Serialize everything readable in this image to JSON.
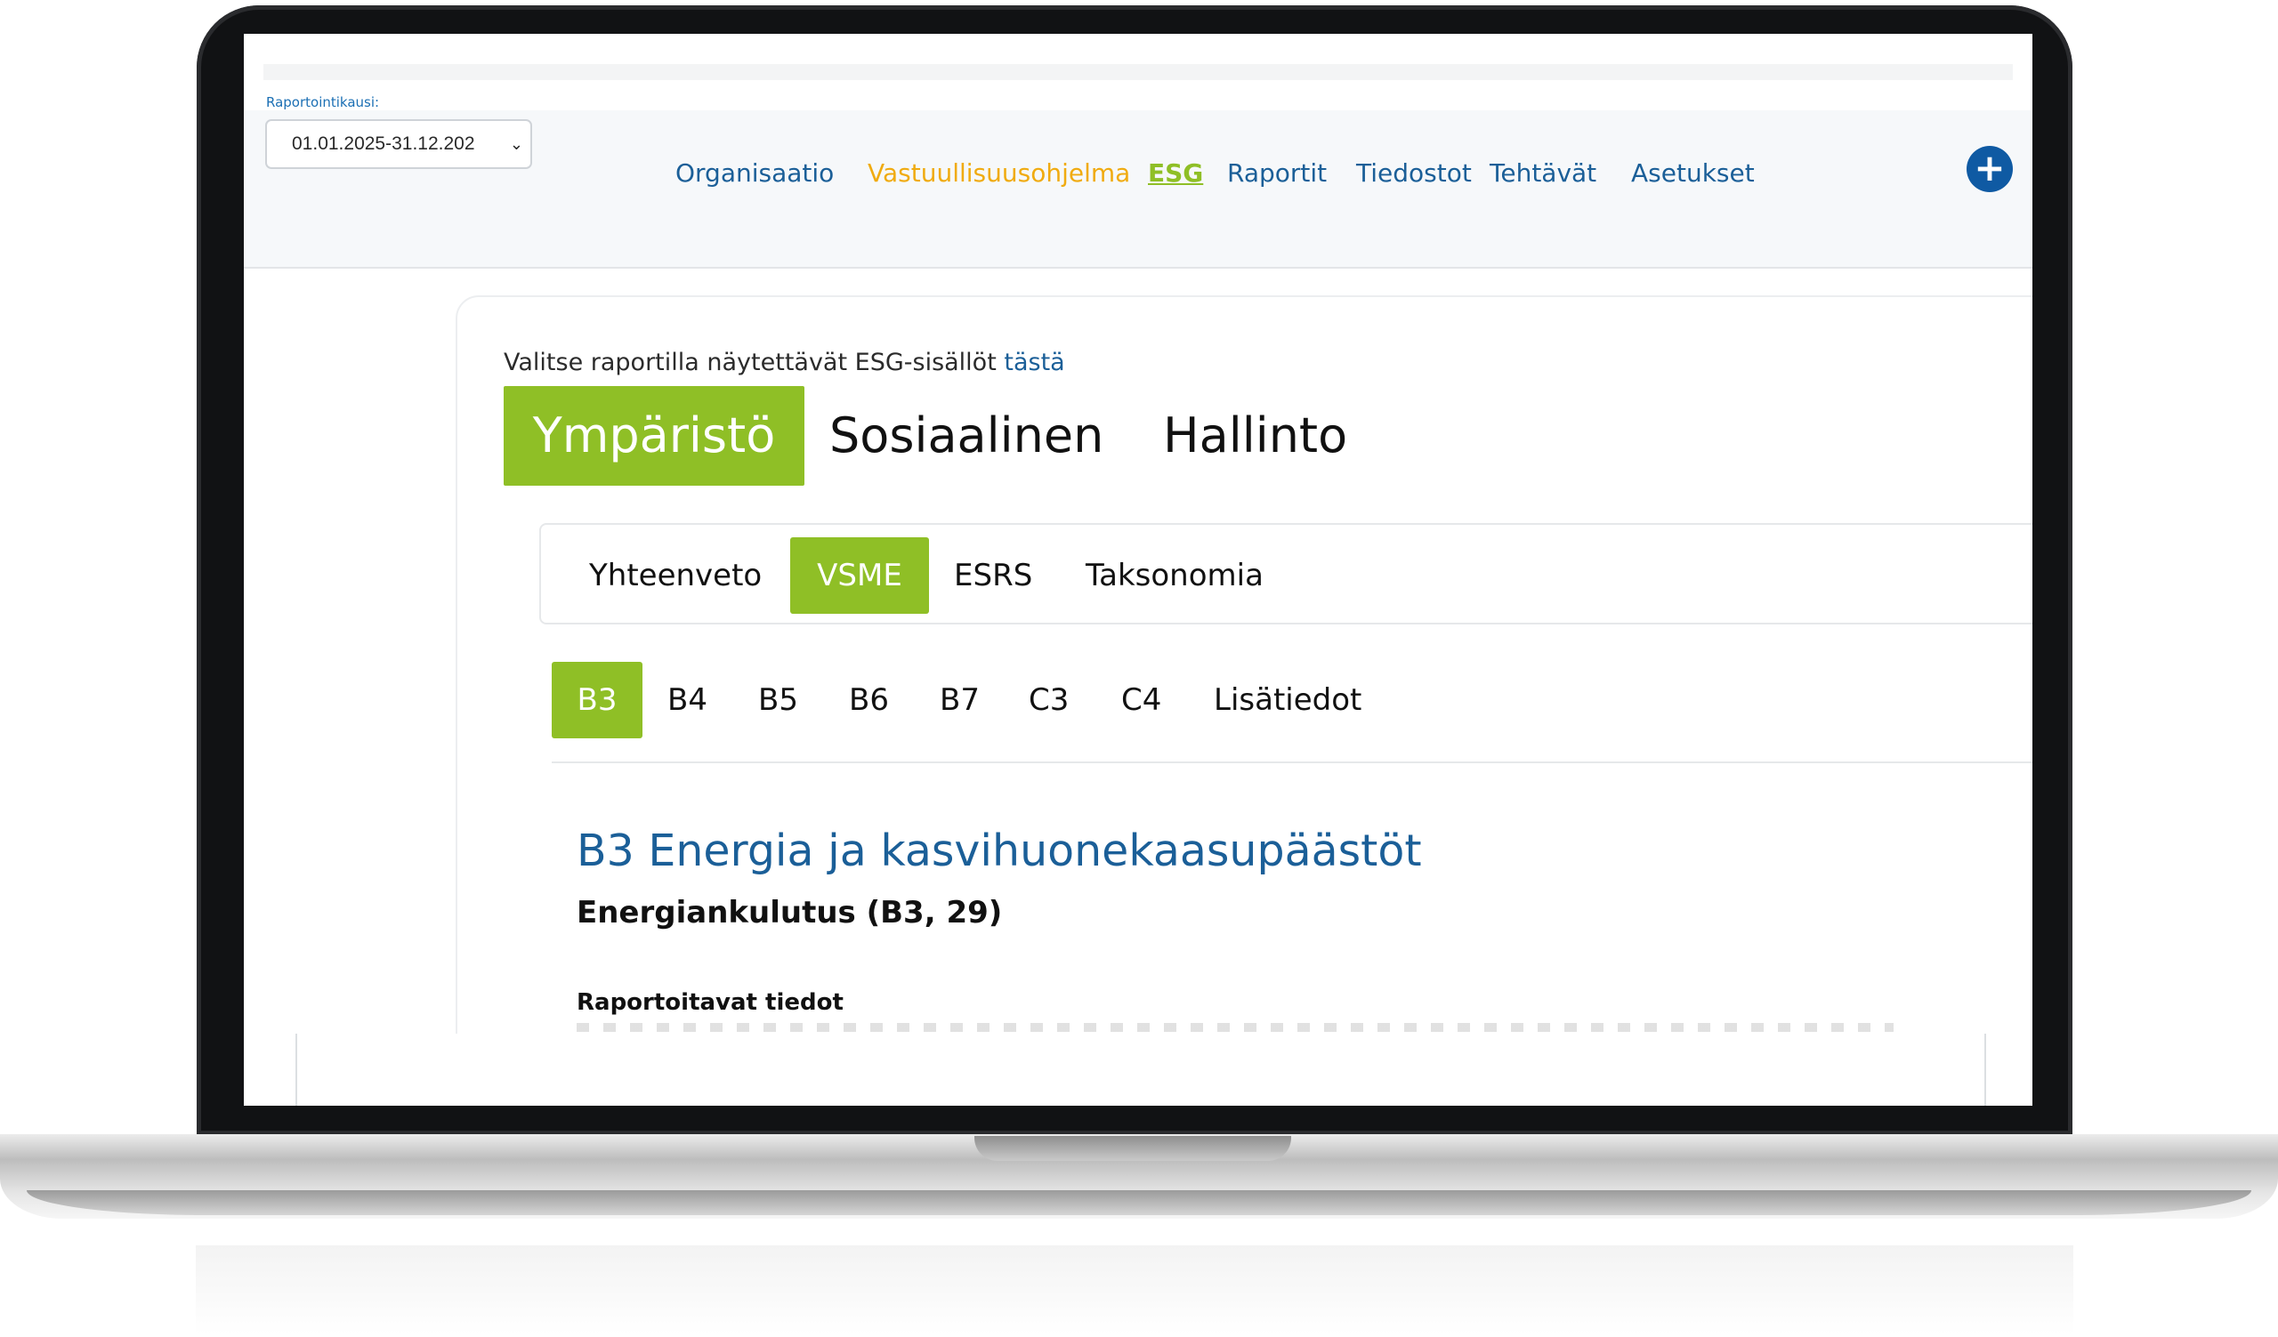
{
  "header": {
    "period_label": "Raportointikausi:",
    "period_value": "01.01.2025-31.12.202"
  },
  "nav": {
    "items": [
      {
        "label": "Organisaatio"
      },
      {
        "label": "Vastuullisuusohjelma"
      },
      {
        "label": "ESG"
      },
      {
        "label": "Raportit"
      },
      {
        "label": "Tiedostot"
      },
      {
        "label": "Tehtävät"
      },
      {
        "label": "Asetukset"
      }
    ],
    "add_button": "+"
  },
  "content": {
    "intro_text": "Valitse raportilla näytettävät ESG-sisällöt",
    "intro_link": "tästä",
    "main_tabs": [
      "Ympäristö",
      "Sosiaalinen",
      "Hallinto"
    ],
    "sub_tabs": [
      "Yhteenveto",
      "VSME",
      "ESRS",
      "Taksonomia"
    ],
    "code_tabs": [
      "B3",
      "B4",
      "B5",
      "B6",
      "B7",
      "C3",
      "C4",
      "Lisätiedot"
    ],
    "section_title": "B3 Energia ja kasvihuonekaasupäästöt",
    "sub_heading": "Energiankulutus (B3, 29)",
    "small_heading": "Raportoitavat tiedot"
  },
  "colors": {
    "accent_green": "#8fbf26",
    "link_blue": "#1b5f98",
    "orange": "#f0ab10",
    "button_blue": "#0f5aa3"
  }
}
